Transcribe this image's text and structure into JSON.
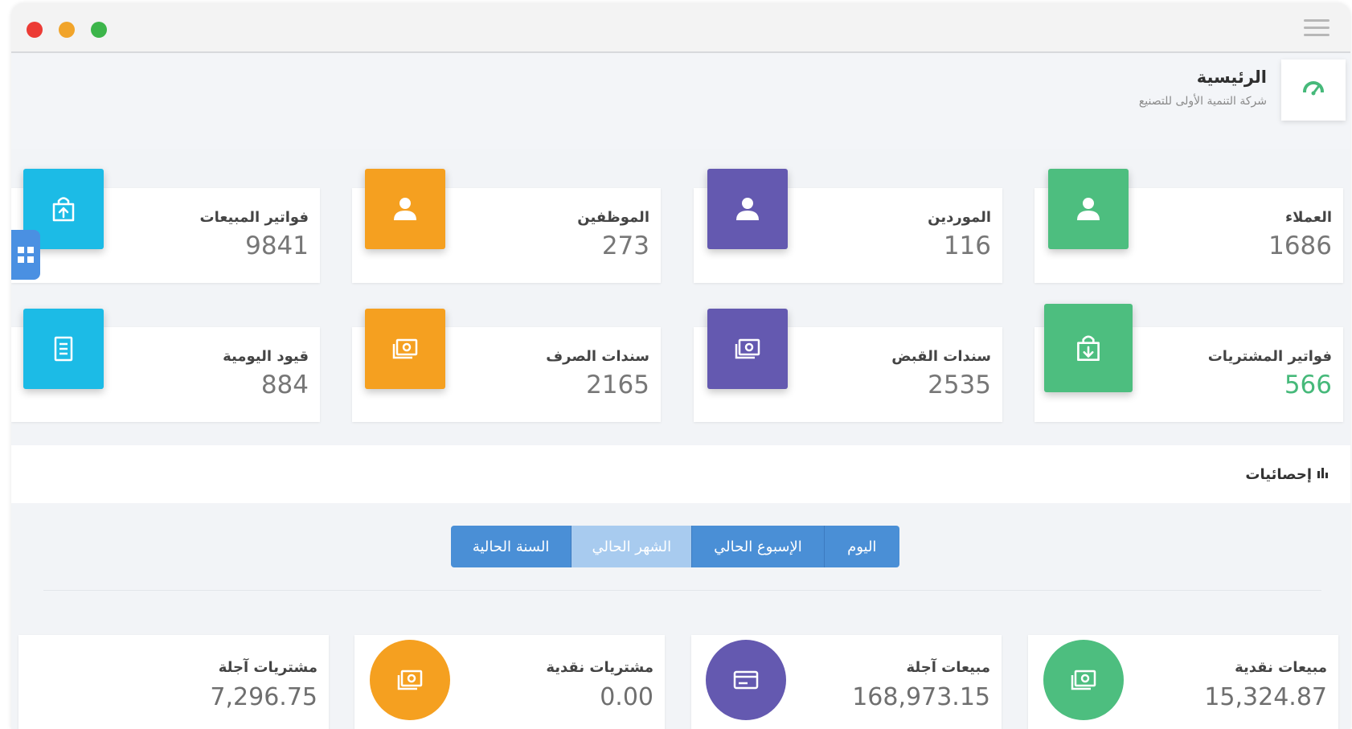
{
  "header": {
    "title": "الرئيسية",
    "subtitle": "شركة التنمية الأولى للتصنيع",
    "icon": "dashboard-icon"
  },
  "stat_cards": [
    {
      "label": "العملاء",
      "value": "1686",
      "icon": "user-icon",
      "color": "#4dbe7f"
    },
    {
      "label": "الموردين",
      "value": "116",
      "icon": "user-icon",
      "color": "#6459b0"
    },
    {
      "label": "الموظفين",
      "value": "273",
      "icon": "user-icon",
      "color": "#f5a020"
    },
    {
      "label": "فواتير المبيعات",
      "value": "9841",
      "icon": "bag-upload-icon",
      "color": "#1cbbe6"
    },
    {
      "label": "فواتير المشتريات",
      "value": "566",
      "icon": "bag-download-icon",
      "color": "#4dbe7f"
    },
    {
      "label": "سندات القبض",
      "value": "2535",
      "icon": "cash-icon",
      "color": "#6459b0"
    },
    {
      "label": "سندات الصرف",
      "value": "2165",
      "icon": "cash-icon",
      "color": "#f5a020"
    },
    {
      "label": "قيود اليومية",
      "value": "884",
      "icon": "document-icon",
      "color": "#1cbbe6"
    }
  ],
  "statistics": {
    "title": "إحصائيات",
    "tabs": [
      {
        "label": "اليوم",
        "active": false
      },
      {
        "label": "الإسبوع الحالي",
        "active": false
      },
      {
        "label": "الشهر الحالي",
        "active": true
      },
      {
        "label": "السنة الحالية",
        "active": false
      }
    ],
    "cards": [
      {
        "label": "مبيعات نقدية",
        "value": "15,324.87",
        "icon": "cash-icon",
        "color": "#4dbe7f"
      },
      {
        "label": "مبيعات آجلة",
        "value": "168,973.15",
        "icon": "credit-card-icon",
        "color": "#6459b0"
      },
      {
        "label": "مشتريات نقدية",
        "value": "0.00",
        "icon": "cash-icon",
        "color": "#f5a020"
      },
      {
        "label": "مشتريات آجلة",
        "value": "7,296.75"
      }
    ]
  },
  "colors": {
    "green": "#4dbe7f",
    "purple": "#6459b0",
    "orange": "#f5a020",
    "cyan": "#1cbbe6",
    "tab_blue": "#4a8fd6"
  }
}
